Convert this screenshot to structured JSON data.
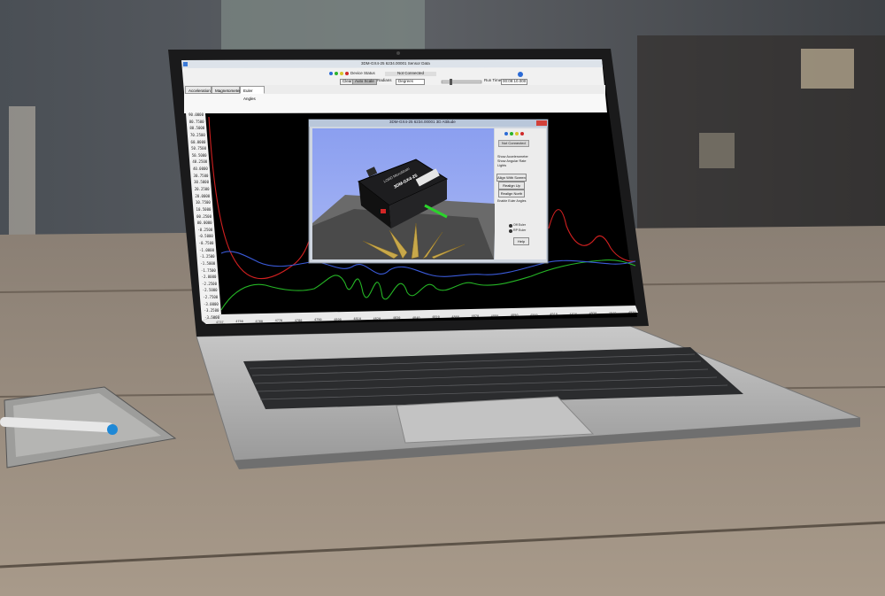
{
  "app": {
    "window_title": "3DM-GX4-25 6234.00001 Sensor Data",
    "device_status_label": "Device Status",
    "device_status_value": "Not Connected",
    "run_time_label": "Run Time",
    "run_time_value": "00:09:10.000",
    "radians_label": "Radians",
    "degrees_label": "Degrees",
    "clear_label": "Clear",
    "auto_scale_label": "Auto Scale"
  },
  "tabs": [
    {
      "label": "Acceleration"
    },
    {
      "label": "Magnetometer"
    },
    {
      "label": "Euler Angles"
    }
  ],
  "chart": {
    "y_ticks": [
      "90.0000",
      "80.7500",
      "80.5000",
      "70.2500",
      "60.0000",
      "50.7500",
      "50.5000",
      "40.2500",
      "40.0000",
      "30.7500",
      "30.5000",
      "20.2500",
      "20.0000",
      "10.7500",
      "10.5000",
      "00.2500",
      "00.0000",
      "-0.2500",
      "-0.5000",
      "-0.7500",
      "-1.0000",
      "-1.2500",
      "-1.5000",
      "-1.7500",
      "-2.0000",
      "-2.2500",
      "-2.5000",
      "-2.7500",
      "-3.0000",
      "-3.2500",
      "-3.5000"
    ],
    "x_ticks": [
      "4737",
      "4750",
      "4760",
      "4770",
      "4780",
      "4790",
      "4800",
      "4810",
      "4820",
      "4830",
      "4840",
      "4850",
      "4860",
      "4870",
      "4880",
      "4890",
      "4900",
      "4910",
      "4920",
      "4930",
      "4940",
      "4950"
    ]
  },
  "model_window": {
    "title": "3DM-GX4-25 6234.00001 3D Attitude",
    "status": "Not Connected",
    "checkboxes": [
      {
        "label": "Show Accelerometer"
      },
      {
        "label": "Show Angular Rate"
      },
      {
        "label": "Lights"
      }
    ],
    "buttons": [
      {
        "label": "Align With Screen"
      },
      {
        "label": "Realign Up"
      },
      {
        "label": "Realign North"
      }
    ],
    "note": "Enable Euler Angles",
    "radio": [
      {
        "label": "Off Euler"
      },
      {
        "label": "RP Euler"
      }
    ],
    "help_label": "Help",
    "device_brand": "LORD MicroStrain",
    "device_model": "3DM-GX4-25"
  },
  "colors": {
    "chart_bg": "#000000",
    "series_red": "#d22020",
    "series_green": "#25b525",
    "series_blue": "#3a5ad8",
    "sky": "#8fa4f2",
    "pen_accent": "#1e88d6"
  }
}
